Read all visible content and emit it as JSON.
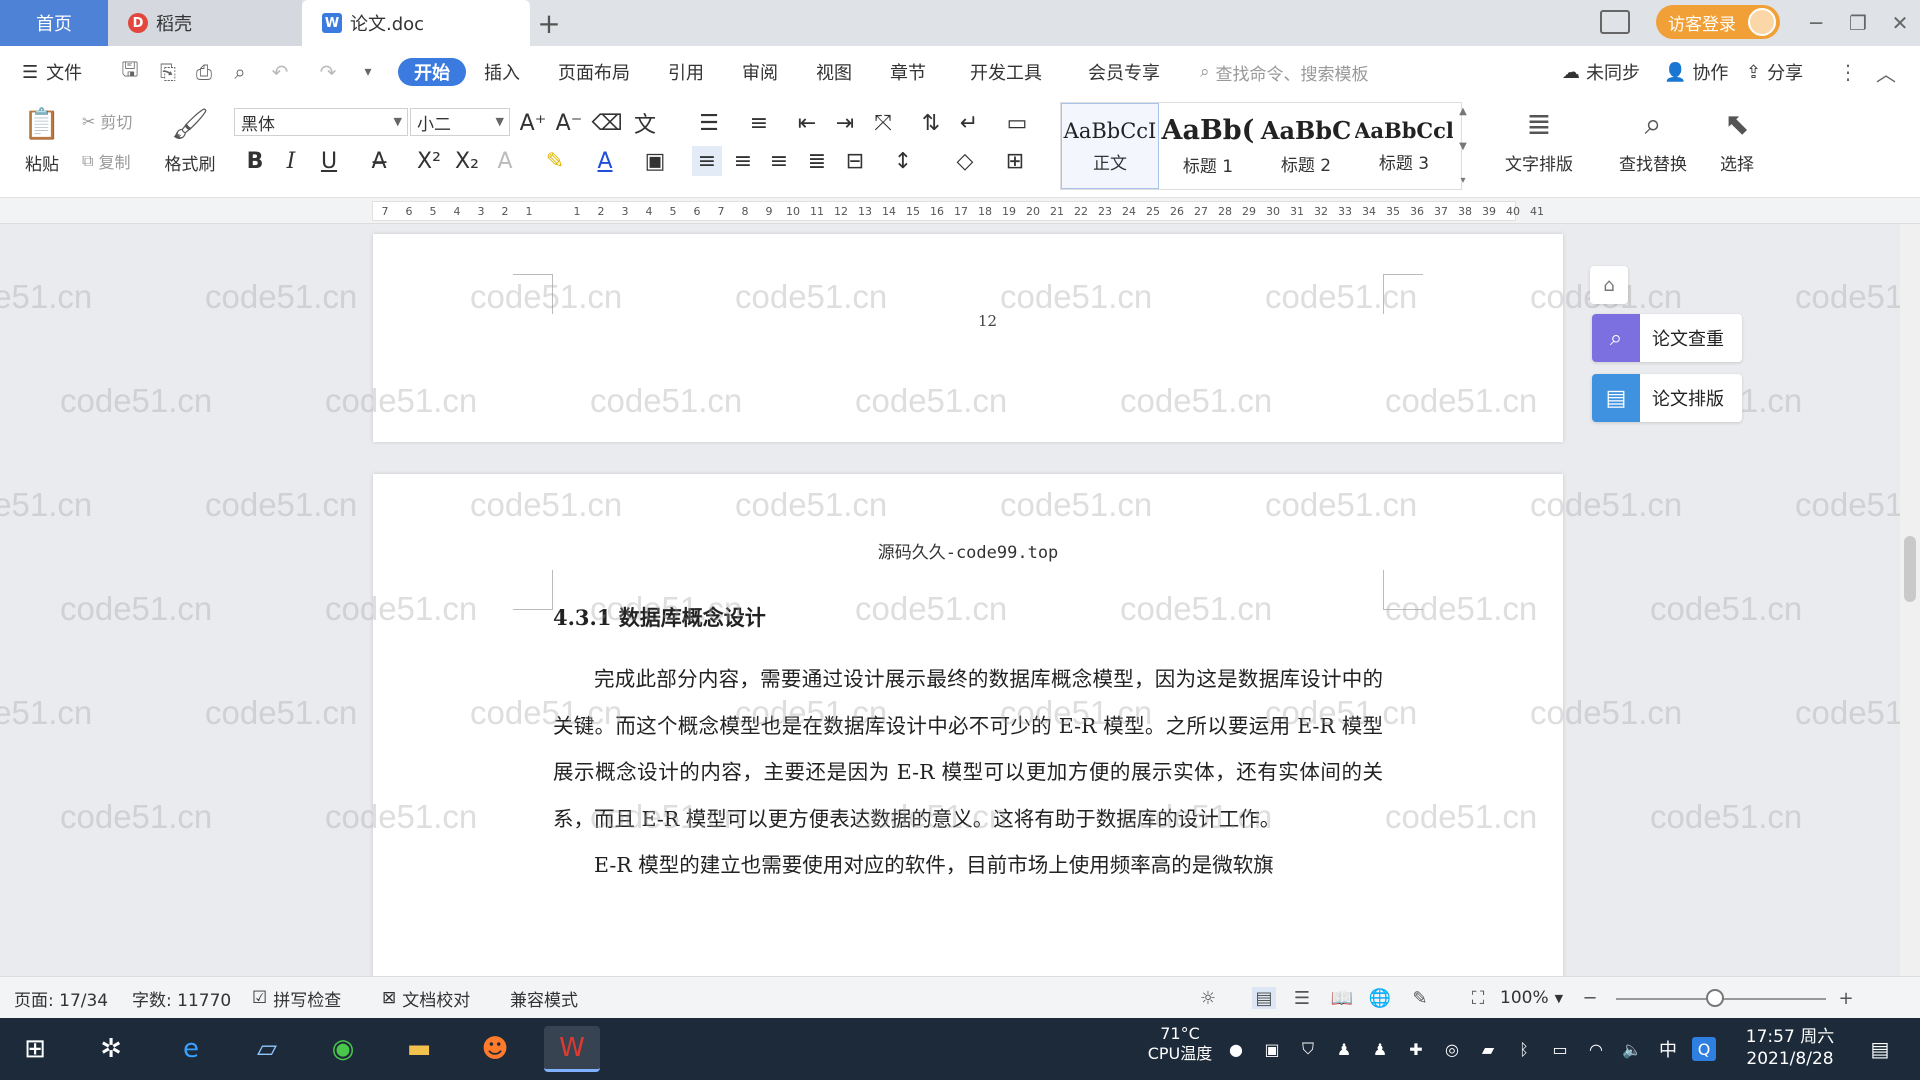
{
  "tabs": {
    "home": "首页",
    "daoke": "稻壳",
    "doc": "论文.doc",
    "add": "+",
    "visitor_login": "访客登录"
  },
  "menu": {
    "file": "文件",
    "items": [
      "开始",
      "插入",
      "页面布局",
      "引用",
      "审阅",
      "视图",
      "章节",
      "开发工具",
      "会员专享"
    ],
    "search_placeholder": "查找命令、搜索模板",
    "sync": "未同步",
    "collab": "协作",
    "share": "分享"
  },
  "ribbon": {
    "paste": "粘贴",
    "cut": "剪切",
    "copy": "复制",
    "format_painter": "格式刷",
    "font_name": "黑体",
    "font_size": "小二",
    "styles": [
      {
        "sample": "AaBbCcI",
        "name": "正文"
      },
      {
        "sample": "AaBb(",
        "name": "标题 1"
      },
      {
        "sample": "AaBbC",
        "name": "标题 2"
      },
      {
        "sample": "AaBbCcl",
        "name": "标题 3"
      }
    ],
    "text_layout": "文字排版",
    "find_replace": "查找替换",
    "select": "选择"
  },
  "ruler": {
    "ticks": [
      "7",
      "6",
      "5",
      "4",
      "3",
      "2",
      "1",
      "",
      "1",
      "2",
      "3",
      "4",
      "5",
      "6",
      "7",
      "8",
      "9",
      "10",
      "11",
      "12",
      "13",
      "14",
      "15",
      "16",
      "17",
      "18",
      "19",
      "20",
      "21",
      "22",
      "23",
      "24",
      "25",
      "26",
      "27",
      "28",
      "29",
      "30",
      "31",
      "32",
      "33",
      "34",
      "35",
      "36",
      "37",
      "38",
      "39",
      "40",
      "41"
    ]
  },
  "document": {
    "page_number": "12",
    "header": "源码久久-code99.top",
    "heading": "4.3.1 数据库概念设计",
    "paragraphs": [
      "完成此部分内容，需要通过设计展示最终的数据库概念模型，因为这是数据库设计中的关键。而这个概念模型也是在数据库设计中必不可少的 E-R 模型。之所以要运用 E-R 模型展示概念设计的内容，主要还是因为 E-R 模型可以更加方便的展示实体，还有实体间的关系，而且 E-R 模型可以更方便表达数据的意义。这将有助于数据库的设计工作。",
      "E-R 模型的建立也需要使用对应的软件，目前市场上使用频率高的是微软旗"
    ],
    "watermark": "code51.cn"
  },
  "side_panel": {
    "paper_check": "论文查重",
    "paper_layout": "论文排版"
  },
  "status": {
    "page": "页面: 17/34",
    "words": "字数: 11770",
    "spell_check": "拼写检查",
    "doc_proofread": "文档校对",
    "compat_mode": "兼容模式",
    "zoom": "100%"
  },
  "taskbar": {
    "cpu_temp": "71°C",
    "cpu_label": "CPU温度",
    "ime": "中",
    "time": "17:57 周六",
    "date": "2021/8/28"
  },
  "colors": {
    "accent": "#3b7be0",
    "home_tab": "#4e82d6",
    "visitor": "#f0a036",
    "taskbar": "#1d2a3a"
  }
}
